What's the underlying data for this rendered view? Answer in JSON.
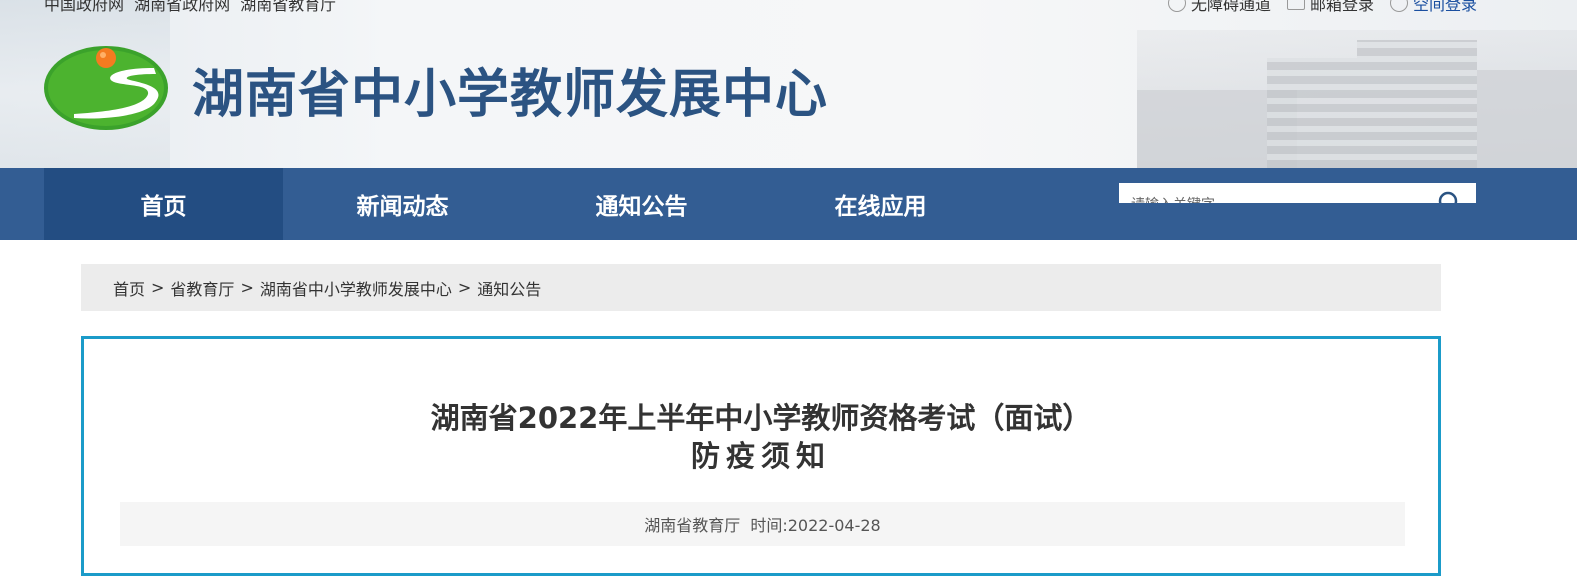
{
  "header": {
    "gov_links": [
      "中国政府网",
      "湖南省政府网",
      "湖南省教育厅"
    ],
    "util_links": [
      {
        "label": "无障碍通道",
        "icon": "eye-icon"
      },
      {
        "label": "邮箱登录",
        "icon": "mail-icon"
      },
      {
        "label": "空间登录",
        "icon": "user-icon"
      }
    ],
    "site_title": "湖南省中小学教师发展中心"
  },
  "nav": {
    "items": [
      "首页",
      "新闻动态",
      "通知公告",
      "在线应用"
    ],
    "active": "首页",
    "search_placeholder": "请输入关键字"
  },
  "breadcrumb": [
    "首页",
    "省教育厅",
    "湖南省中小学教师发展中心",
    "通知公告"
  ],
  "article": {
    "title_line1": "湖南省2022年上半年中小学教师资格考试（面试）",
    "title_line2": "防疫须知",
    "source": "湖南省教育厅",
    "time_label": "时间:",
    "date": "2022-04-28"
  },
  "colors": {
    "nav_bg": "#335d93",
    "nav_active": "#234d82",
    "title_blue": "#2b5382",
    "article_border": "#1b9bc9"
  }
}
